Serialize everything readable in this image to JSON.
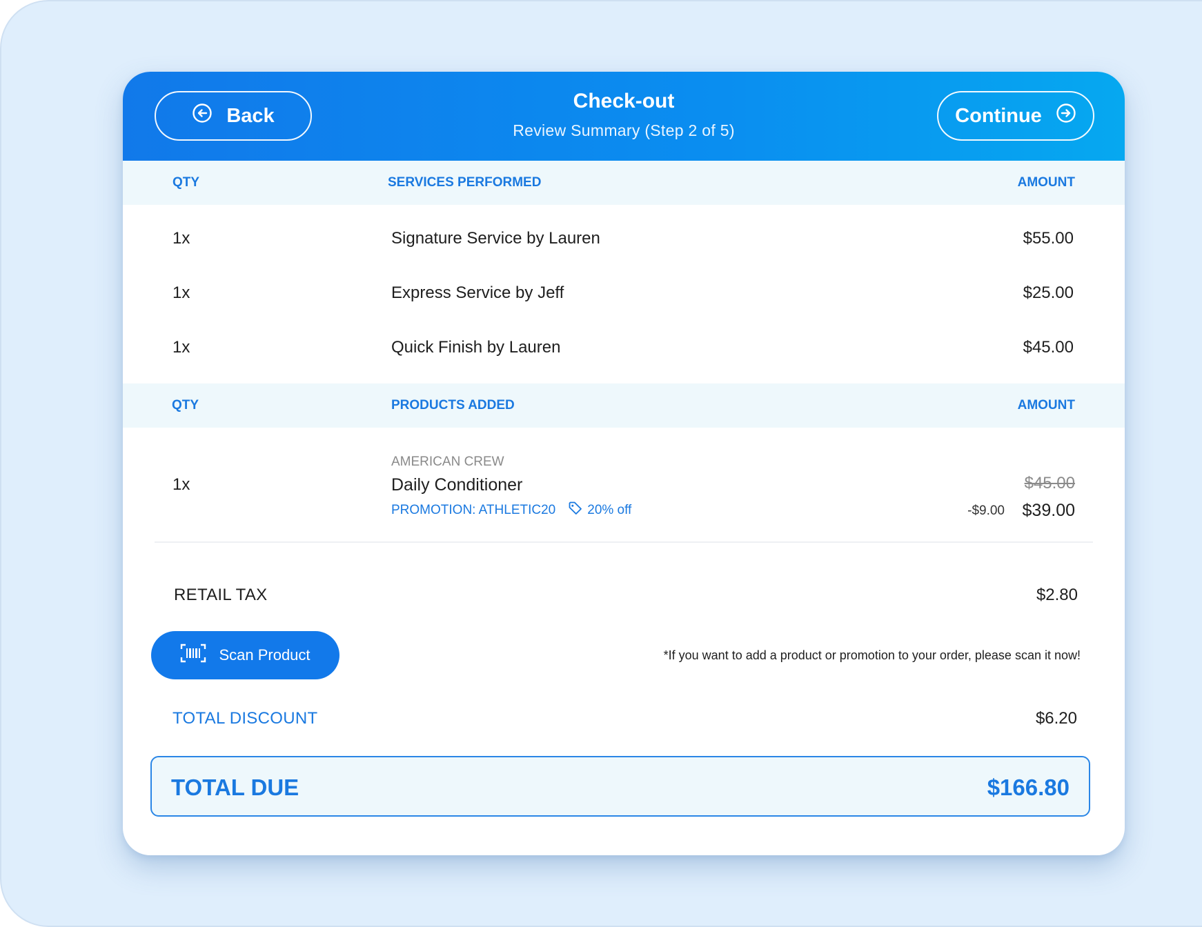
{
  "header": {
    "title": "Check-out",
    "subtitle": "Review Summary (Step 2 of 5)",
    "back_label": "Back",
    "continue_label": "Continue"
  },
  "services": {
    "col_qty": "QTY",
    "col_name": "SERVICES PERFORMED",
    "col_amount": "AMOUNT",
    "rows": [
      {
        "qty": "1x",
        "name": "Signature Service by Lauren",
        "amount": "$55.00"
      },
      {
        "qty": "1x",
        "name": "Express Service by Jeff",
        "amount": "$25.00"
      },
      {
        "qty": "1x",
        "name": "Quick Finish by Lauren",
        "amount": "$45.00"
      }
    ]
  },
  "products": {
    "col_qty": "QTY",
    "col_name": "PRODUCTS ADDED",
    "col_amount": "AMOUNT",
    "rows": [
      {
        "qty": "1x",
        "brand": "AMERICAN CREW",
        "name": "Daily Conditioner",
        "promotion": "PROMOTION: ATHLETIC20",
        "promo_tag": "20% off",
        "original_amount": "$45.00",
        "discount": "-$9.00",
        "amount": "$39.00"
      }
    ]
  },
  "summary": {
    "tax_label": "RETAIL TAX",
    "tax_value": "$2.80",
    "scan_label": "Scan Product",
    "scan_note": "*If you want to add a product or promotion to your order, please scan it now!",
    "discount_label": "TOTAL DISCOUNT",
    "discount_value": "$6.20",
    "total_label": "TOTAL DUE",
    "total_value": "$166.80"
  },
  "colors": {
    "accent": "#1279ea",
    "header_end": "#06a8f0",
    "table_header_bg": "#eef8fc",
    "page_bg": "#dfeefc"
  },
  "icons": [
    "arrow-left-circle-icon",
    "arrow-right-circle-icon",
    "tag-icon",
    "barcode-scan-icon"
  ]
}
